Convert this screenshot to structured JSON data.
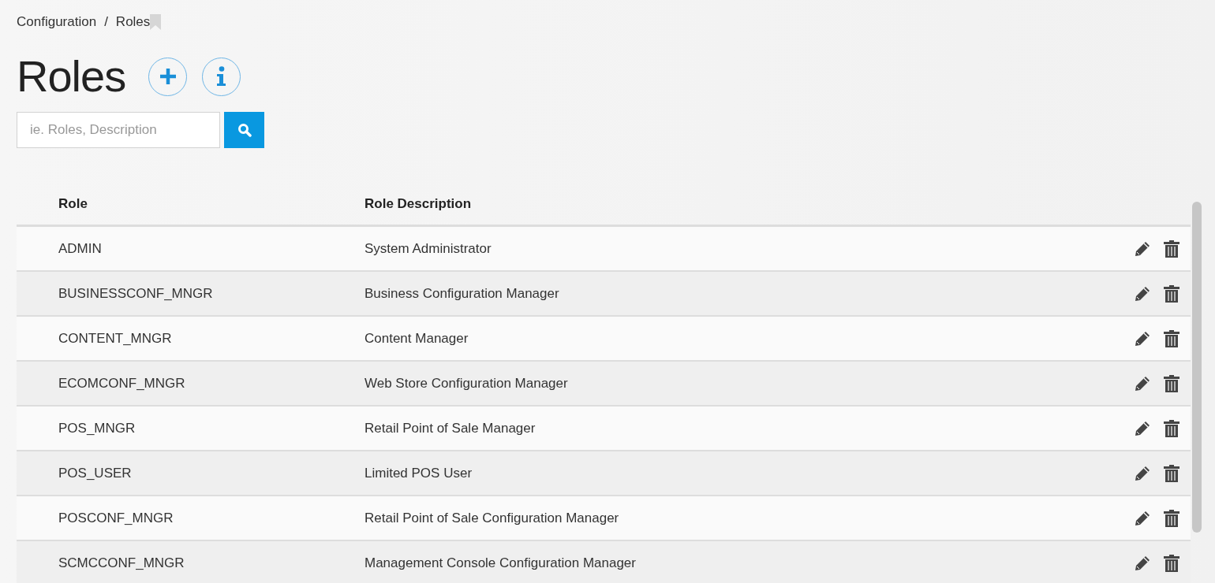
{
  "breadcrumb": [
    {
      "label": "Configuration"
    },
    {
      "label": "Roles"
    }
  ],
  "breadcrumb_separator": "/",
  "page_title": "Roles",
  "search": {
    "placeholder": "ie. Roles, Description"
  },
  "table": {
    "columns": [
      "Role",
      "Role Description"
    ],
    "rows": [
      {
        "role": "ADMIN",
        "description": "System Administrator"
      },
      {
        "role": "BUSINESSCONF_MNGR",
        "description": "Business Configuration Manager"
      },
      {
        "role": "CONTENT_MNGR",
        "description": "Content Manager"
      },
      {
        "role": "ECOMCONF_MNGR",
        "description": "Web Store Configuration Manager"
      },
      {
        "role": "POS_MNGR",
        "description": "Retail Point of Sale Manager"
      },
      {
        "role": "POS_USER",
        "description": "Limited POS User"
      },
      {
        "role": "POSCONF_MNGR",
        "description": "Retail Point of Sale Configuration Manager"
      },
      {
        "role": "SCMCCONF_MNGR",
        "description": "Management Console Configuration Manager"
      }
    ]
  }
}
